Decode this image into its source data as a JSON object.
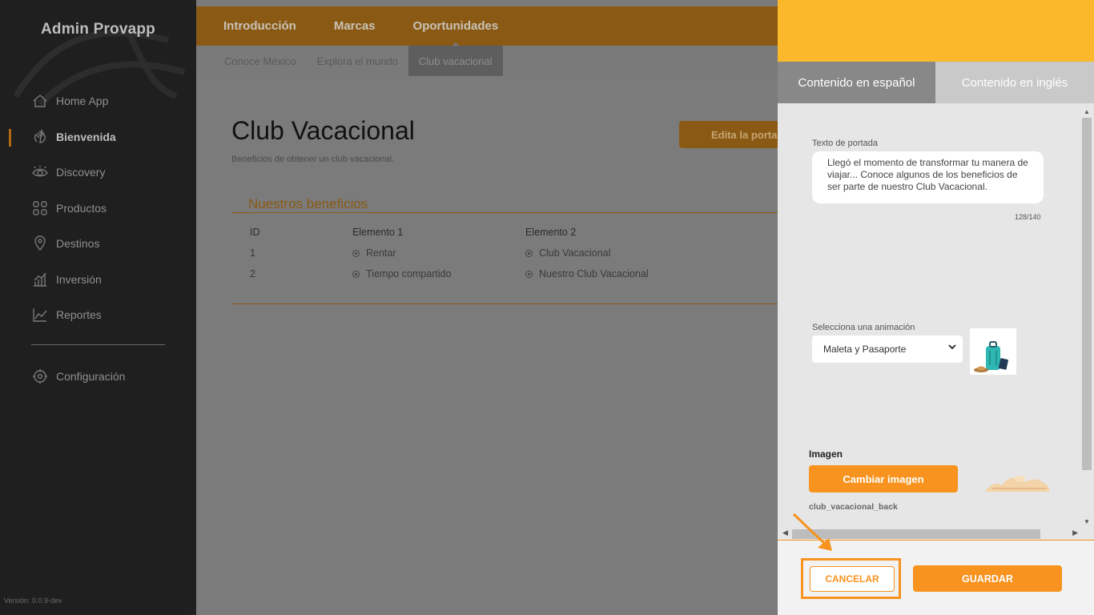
{
  "sidebar": {
    "brand": "Admin Provapp",
    "items": [
      {
        "label": "Home App",
        "icon": "home-icon"
      },
      {
        "label": "Bienvenida",
        "icon": "wave-hand-icon",
        "active": true
      },
      {
        "label": "Discovery",
        "icon": "eye-icon"
      },
      {
        "label": "Productos",
        "icon": "grid-icon"
      },
      {
        "label": "Destinos",
        "icon": "map-pin-icon"
      },
      {
        "label": "Inversión",
        "icon": "bar-chart-icon"
      },
      {
        "label": "Reportes",
        "icon": "line-chart-icon"
      }
    ],
    "config": {
      "label": "Configuración",
      "icon": "gear-icon"
    },
    "version": "Versión: 0.0.9-dev"
  },
  "topnav": {
    "tabs": [
      "Introducción",
      "Marcas",
      "Oportunidades"
    ],
    "active": "Oportunidades"
  },
  "subnav": {
    "tabs": [
      "Conoce México",
      "Explora el mundo",
      "Club vacacional"
    ],
    "active": "Club vacacional"
  },
  "main": {
    "title": "Club Vacacional",
    "subtitle": "Beneficios de obtener un club vacacional.",
    "edit_button": "Edita la portada",
    "section_title": "Nuestros beneficios",
    "table": {
      "headers": [
        "ID",
        "Elemento 1",
        "Elemento 2"
      ],
      "rows": [
        [
          "1",
          "Rentar",
          "Club Vacacional"
        ],
        [
          "2",
          "Tiempo compartido",
          "Nuestro Club Vacacional"
        ]
      ]
    }
  },
  "panel": {
    "tabs": [
      "Contenido en español",
      "Contenido en inglés"
    ],
    "cover_text_label": "Texto de portada",
    "cover_text": "Llegó el momento de transformar tu manera de viajar... Conoce algunos de los beneficios de ser parte de nuestro Club Vacacional.",
    "counter": "128/140",
    "animation_label": "Selecciona una animación",
    "animation_value": "Maleta y Pasaporte",
    "image_label": "Imagen",
    "change_image_button": "Cambiar imagen",
    "file_name": "club_vacacional_back",
    "cancel_button": "CANCELAR",
    "save_button": "GUARDAR"
  },
  "colors": {
    "accent": "#f7931e",
    "panel_header": "#fab82a",
    "sidebar_bg": "#1f1f1f"
  }
}
